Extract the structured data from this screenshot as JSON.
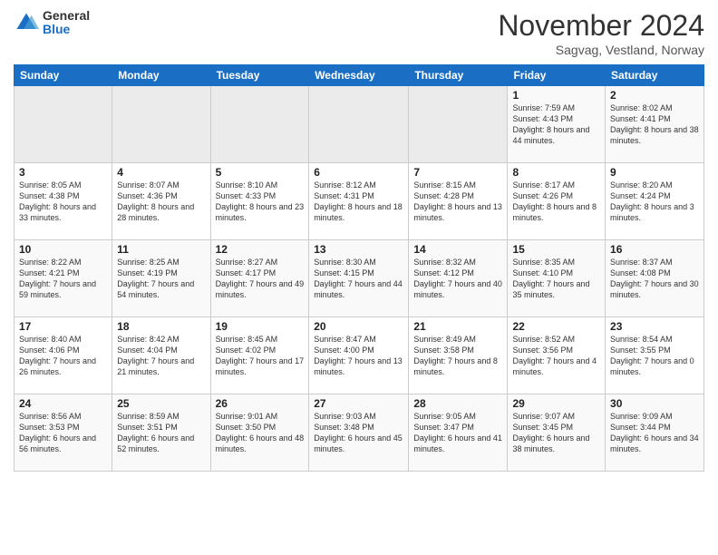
{
  "logo": {
    "general": "General",
    "blue": "Blue"
  },
  "title": "November 2024",
  "location": "Sagvag, Vestland, Norway",
  "headers": [
    "Sunday",
    "Monday",
    "Tuesday",
    "Wednesday",
    "Thursday",
    "Friday",
    "Saturday"
  ],
  "weeks": [
    [
      {
        "num": "",
        "info": ""
      },
      {
        "num": "",
        "info": ""
      },
      {
        "num": "",
        "info": ""
      },
      {
        "num": "",
        "info": ""
      },
      {
        "num": "",
        "info": ""
      },
      {
        "num": "1",
        "info": "Sunrise: 7:59 AM\nSunset: 4:43 PM\nDaylight: 8 hours and 44 minutes."
      },
      {
        "num": "2",
        "info": "Sunrise: 8:02 AM\nSunset: 4:41 PM\nDaylight: 8 hours and 38 minutes."
      }
    ],
    [
      {
        "num": "3",
        "info": "Sunrise: 8:05 AM\nSunset: 4:38 PM\nDaylight: 8 hours and 33 minutes."
      },
      {
        "num": "4",
        "info": "Sunrise: 8:07 AM\nSunset: 4:36 PM\nDaylight: 8 hours and 28 minutes."
      },
      {
        "num": "5",
        "info": "Sunrise: 8:10 AM\nSunset: 4:33 PM\nDaylight: 8 hours and 23 minutes."
      },
      {
        "num": "6",
        "info": "Sunrise: 8:12 AM\nSunset: 4:31 PM\nDaylight: 8 hours and 18 minutes."
      },
      {
        "num": "7",
        "info": "Sunrise: 8:15 AM\nSunset: 4:28 PM\nDaylight: 8 hours and 13 minutes."
      },
      {
        "num": "8",
        "info": "Sunrise: 8:17 AM\nSunset: 4:26 PM\nDaylight: 8 hours and 8 minutes."
      },
      {
        "num": "9",
        "info": "Sunrise: 8:20 AM\nSunset: 4:24 PM\nDaylight: 8 hours and 3 minutes."
      }
    ],
    [
      {
        "num": "10",
        "info": "Sunrise: 8:22 AM\nSunset: 4:21 PM\nDaylight: 7 hours and 59 minutes."
      },
      {
        "num": "11",
        "info": "Sunrise: 8:25 AM\nSunset: 4:19 PM\nDaylight: 7 hours and 54 minutes."
      },
      {
        "num": "12",
        "info": "Sunrise: 8:27 AM\nSunset: 4:17 PM\nDaylight: 7 hours and 49 minutes."
      },
      {
        "num": "13",
        "info": "Sunrise: 8:30 AM\nSunset: 4:15 PM\nDaylight: 7 hours and 44 minutes."
      },
      {
        "num": "14",
        "info": "Sunrise: 8:32 AM\nSunset: 4:12 PM\nDaylight: 7 hours and 40 minutes."
      },
      {
        "num": "15",
        "info": "Sunrise: 8:35 AM\nSunset: 4:10 PM\nDaylight: 7 hours and 35 minutes."
      },
      {
        "num": "16",
        "info": "Sunrise: 8:37 AM\nSunset: 4:08 PM\nDaylight: 7 hours and 30 minutes."
      }
    ],
    [
      {
        "num": "17",
        "info": "Sunrise: 8:40 AM\nSunset: 4:06 PM\nDaylight: 7 hours and 26 minutes."
      },
      {
        "num": "18",
        "info": "Sunrise: 8:42 AM\nSunset: 4:04 PM\nDaylight: 7 hours and 21 minutes."
      },
      {
        "num": "19",
        "info": "Sunrise: 8:45 AM\nSunset: 4:02 PM\nDaylight: 7 hours and 17 minutes."
      },
      {
        "num": "20",
        "info": "Sunrise: 8:47 AM\nSunset: 4:00 PM\nDaylight: 7 hours and 13 minutes."
      },
      {
        "num": "21",
        "info": "Sunrise: 8:49 AM\nSunset: 3:58 PM\nDaylight: 7 hours and 8 minutes."
      },
      {
        "num": "22",
        "info": "Sunrise: 8:52 AM\nSunset: 3:56 PM\nDaylight: 7 hours and 4 minutes."
      },
      {
        "num": "23",
        "info": "Sunrise: 8:54 AM\nSunset: 3:55 PM\nDaylight: 7 hours and 0 minutes."
      }
    ],
    [
      {
        "num": "24",
        "info": "Sunrise: 8:56 AM\nSunset: 3:53 PM\nDaylight: 6 hours and 56 minutes."
      },
      {
        "num": "25",
        "info": "Sunrise: 8:59 AM\nSunset: 3:51 PM\nDaylight: 6 hours and 52 minutes."
      },
      {
        "num": "26",
        "info": "Sunrise: 9:01 AM\nSunset: 3:50 PM\nDaylight: 6 hours and 48 minutes."
      },
      {
        "num": "27",
        "info": "Sunrise: 9:03 AM\nSunset: 3:48 PM\nDaylight: 6 hours and 45 minutes."
      },
      {
        "num": "28",
        "info": "Sunrise: 9:05 AM\nSunset: 3:47 PM\nDaylight: 6 hours and 41 minutes."
      },
      {
        "num": "29",
        "info": "Sunrise: 9:07 AM\nSunset: 3:45 PM\nDaylight: 6 hours and 38 minutes."
      },
      {
        "num": "30",
        "info": "Sunrise: 9:09 AM\nSunset: 3:44 PM\nDaylight: 6 hours and 34 minutes."
      }
    ]
  ]
}
